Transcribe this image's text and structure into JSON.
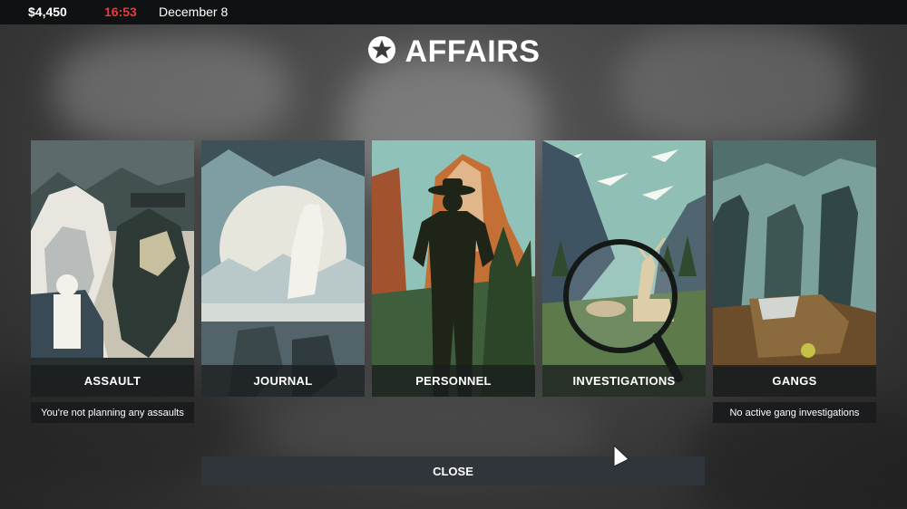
{
  "hud": {
    "money": "$4,450",
    "time": "16:53",
    "date": "December 8"
  },
  "title": {
    "text": "AFFAIRS",
    "icon": "star-icon"
  },
  "cards": [
    {
      "label": "ASSAULT",
      "status": "You're not planning any assaults"
    },
    {
      "label": "JOURNAL"
    },
    {
      "label": "PERSONNEL"
    },
    {
      "label": "INVESTIGATIONS"
    },
    {
      "label": "GANGS",
      "status": "No active gang investigations"
    }
  ],
  "close": {
    "label": "CLOSE"
  },
  "colors": {
    "time": "#e43d3d",
    "topbar": "#101112",
    "close_bg": "#30343b"
  }
}
